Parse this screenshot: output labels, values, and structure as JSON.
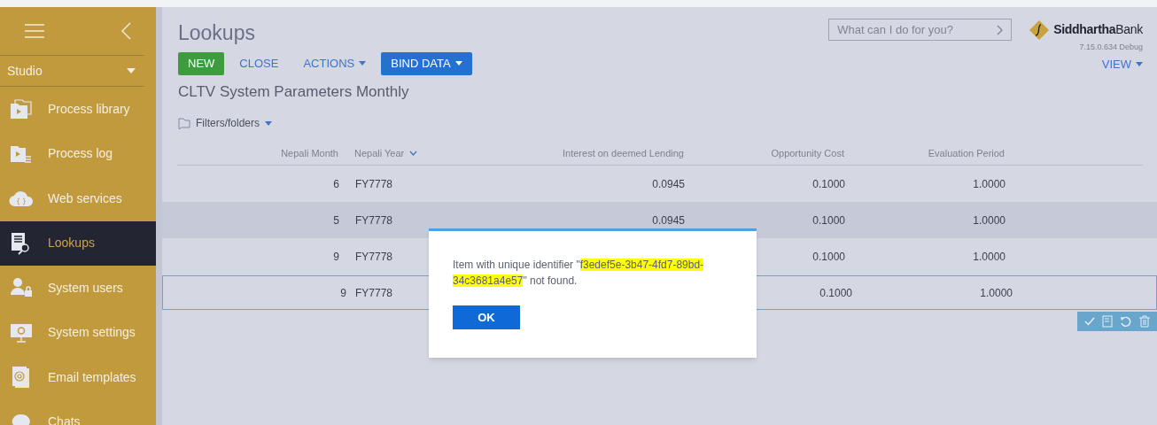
{
  "sidebar": {
    "section": "Studio",
    "items": [
      {
        "label": "Process library",
        "selected": false
      },
      {
        "label": "Process log",
        "selected": false
      },
      {
        "label": "Web services",
        "selected": false
      },
      {
        "label": "Lookups",
        "selected": true
      },
      {
        "label": "System users",
        "selected": false
      },
      {
        "label": "System settings",
        "selected": false
      },
      {
        "label": "Email templates",
        "selected": false
      },
      {
        "label": "Chats",
        "selected": false
      }
    ]
  },
  "header": {
    "title": "Lookups",
    "search": {
      "placeholder": "What can I do for you?"
    },
    "logo": {
      "bold": "Siddhartha",
      "light": "Bank"
    },
    "version": "7.15.0.634 Debug"
  },
  "toolbar": {
    "buttons": [
      {
        "label": "NEW",
        "kind": "primary",
        "dropdown": false
      },
      {
        "label": "CLOSE",
        "kind": "link",
        "dropdown": false
      },
      {
        "label": "ACTIONS",
        "kind": "link",
        "dropdown": true
      },
      {
        "label": "BIND DATA",
        "kind": "accent",
        "dropdown": true
      }
    ],
    "view": "VIEW"
  },
  "subtitle": "CLTV System Parameters Monthly",
  "filters": "Filters/folders",
  "table": {
    "columns": [
      {
        "label": "Nepali Month",
        "sorted": false
      },
      {
        "label": "Nepali Year",
        "sorted": true
      },
      {
        "label": "Interest on deemed Lending",
        "sorted": false
      },
      {
        "label": "Opportunity Cost",
        "sorted": false
      },
      {
        "label": "Evaluation Period",
        "sorted": false
      }
    ],
    "rows": [
      {
        "cells": [
          "6",
          "FY7778",
          "0.0945",
          "0.1000",
          "1.0000"
        ],
        "selected": false,
        "hovered": false
      },
      {
        "cells": [
          "5",
          "FY7778",
          "0.0945",
          "0.1000",
          "1.0000"
        ],
        "selected": false,
        "hovered": true
      },
      {
        "cells": [
          "9",
          "FY7778",
          "",
          "0.1000",
          "1.0000"
        ],
        "selected": false,
        "hovered": false
      },
      {
        "cells": [
          "9",
          "FY7778",
          "",
          "0.1000",
          "1.0000"
        ],
        "selected": true,
        "hovered": false
      }
    ]
  },
  "dialog": {
    "message": [
      {
        "text": "Item with unique identifier \"",
        "highlighted": false
      },
      {
        "text": "f3edef5e-3b47-4fd7-89bd-34c3681a4e57",
        "highlighted": true
      },
      {
        "text": "\" not found.",
        "highlighted": false
      }
    ],
    "button": "OK"
  }
}
